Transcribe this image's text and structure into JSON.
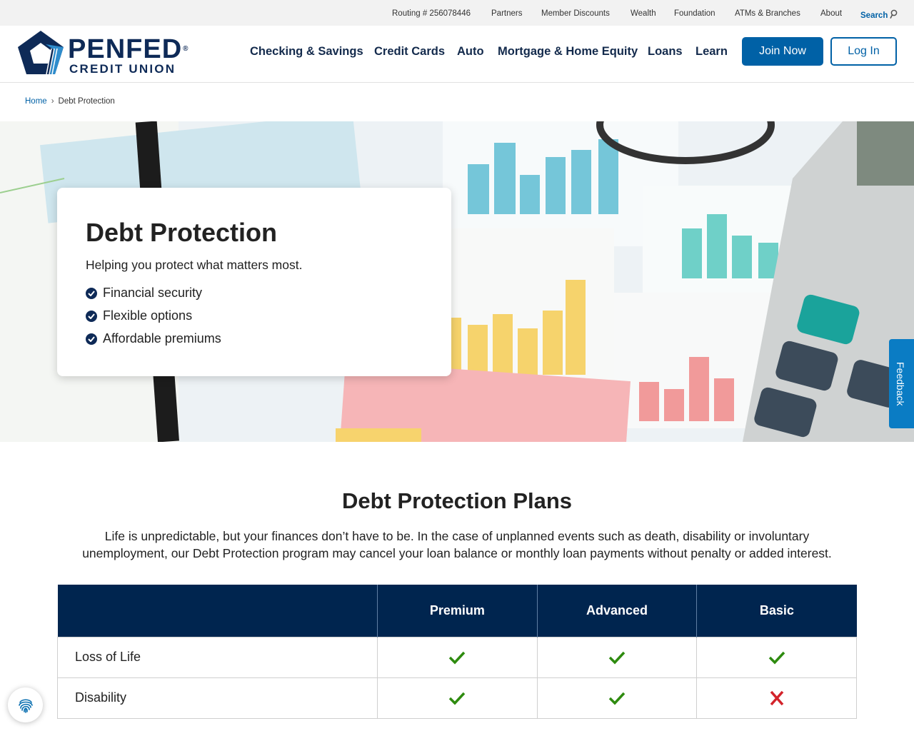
{
  "utility_nav": {
    "routing": "Routing # 256078446",
    "partners": "Partners",
    "member_discounts": "Member Discounts",
    "wealth": "Wealth",
    "foundation": "Foundation",
    "atms": "ATMs & Branches",
    "about": "About",
    "search": "Search"
  },
  "logo": {
    "line1": "PENFED",
    "line2": "CREDIT UNION",
    "registered_mark": "®"
  },
  "main_nav": {
    "checking": "Checking & Savings",
    "credit_cards": "Credit Cards",
    "auto": "Auto",
    "mortgage": "Mortgage & Home Equity",
    "loans": "Loans",
    "learn": "Learn",
    "join": "Join Now",
    "login": "Log In"
  },
  "breadcrumb": {
    "home": "Home",
    "separator": "›",
    "current": "Debt Protection"
  },
  "hero": {
    "title": "Debt Protection",
    "subtitle": "Helping you protect what matters most.",
    "bullets": [
      "Financial security",
      "Flexible options",
      "Affordable premiums"
    ]
  },
  "feedback_label": "Feedback",
  "plans": {
    "title": "Debt Protection Plans",
    "description": "Life is unpredictable, but your finances don’t have to be. In the case of unplanned events such as death, disability or involuntary unemployment, our Debt Protection program may cancel your loan balance or monthly loan payments without penalty or added interest.",
    "columns": [
      "Premium",
      "Advanced",
      "Basic"
    ],
    "rows": [
      {
        "label": "Loss of Life",
        "values": [
          true,
          true,
          true
        ]
      },
      {
        "label": "Disability",
        "values": [
          true,
          true,
          false
        ]
      }
    ]
  },
  "colors": {
    "brand_navy": "#00254f",
    "brand_blue": "#0061a6",
    "check_green": "#2e8b0f",
    "cross_red": "#d3232b"
  },
  "icons": {
    "search": "search-icon",
    "check": "check-icon",
    "cross": "cross-icon",
    "privacy": "fingerprint-icon"
  }
}
